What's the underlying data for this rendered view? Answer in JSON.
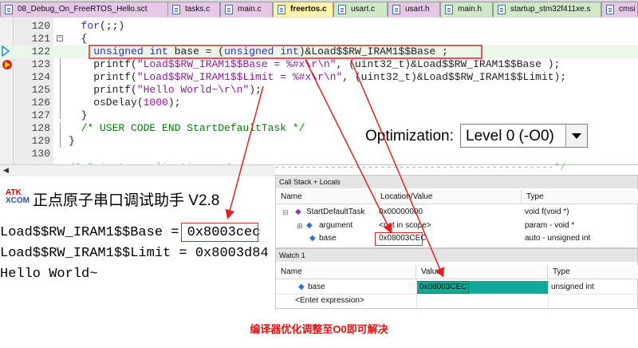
{
  "tabs": [
    {
      "label": "08_Debug_On_FreeRTOS_Hello.sct",
      "color": "#e6c7e6"
    },
    {
      "label": "tasks.c",
      "color": "#e6c7e6"
    },
    {
      "label": "main.c",
      "color": "#e6c7e6"
    },
    {
      "label": "freertos.c",
      "color": "#fff3a8"
    },
    {
      "label": "usart.c",
      "color": "#cfe8c8"
    },
    {
      "label": "usart.h",
      "color": "#e6c7e6"
    },
    {
      "label": "main.h",
      "color": "#cfe8c8"
    },
    {
      "label": "startup_stm32f411xe.s",
      "color": "#cfe8c8"
    },
    {
      "label": "cmsi",
      "color": "#e6c7e6"
    }
  ],
  "editor": {
    "lines": [
      {
        "num": "120",
        "text": "  for(;;)"
      },
      {
        "num": "121",
        "text": "  {"
      },
      {
        "num": "122",
        "text": "    unsigned int base = (unsigned int)&Load$$RW_IRAM1$$Base ;"
      },
      {
        "num": "123",
        "text": "    printf(\"Load$$RW_IRAM1$$Base = %#x\\r\\n\", (uint32_t)&Load$$RW_IRAM1$$Base );"
      },
      {
        "num": "124",
        "text": "    printf(\"Load$$RW_IRAM1$$Limit = %#x\\r\\n\", (uint32_t)&Load$$RW_IRAM1$$Limit);"
      },
      {
        "num": "125",
        "text": "    printf(\"Hello World~\\r\\n\");"
      },
      {
        "num": "126",
        "text": "    osDelay(1000);"
      },
      {
        "num": "127",
        "text": "  }"
      },
      {
        "num": "128",
        "text": "  /* USER CODE END StartDefaultTask */"
      },
      {
        "num": "129",
        "text": "}"
      },
      {
        "num": "130",
        "text": ""
      }
    ],
    "partial_line": "/* Private application code --------------------------------------------------*/"
  },
  "optimization": {
    "label": "Optimization:",
    "value": "Level 0 (-O0)"
  },
  "serial": {
    "logo_top": "ATK",
    "logo_bottom": "XCOM",
    "title": "正点原子串口调试助手 V2.8",
    "line1_prefix": "Load$$RW_IRAM1$$Base = ",
    "line1_value": "0x8003cec",
    "line2": "Load$$RW_IRAM1$$Limit = 0x8003d84",
    "line3": "Hello World~"
  },
  "callstack": {
    "title": "Call Stack + Locals",
    "headers": [
      "Name",
      "Location/Value",
      "Type"
    ],
    "rows": [
      {
        "name": "StartDefaultTask",
        "value": "0x00000000",
        "type": "void f(void *)"
      },
      {
        "name": "argument",
        "value": "<not in scope>",
        "type": "param - void *"
      },
      {
        "name": "base",
        "value": "0x08003CEC",
        "type": "auto - unsigned int"
      }
    ]
  },
  "watch": {
    "title": "Watch 1",
    "headers": [
      "Name",
      "Value",
      "Type"
    ],
    "rows": [
      {
        "name": "base",
        "value": "0x08003CEC",
        "type": "unsigned int"
      },
      {
        "name": "<Enter expression>",
        "value": "",
        "type": ""
      }
    ]
  },
  "note": "编译器优化调整至O0即可解决"
}
